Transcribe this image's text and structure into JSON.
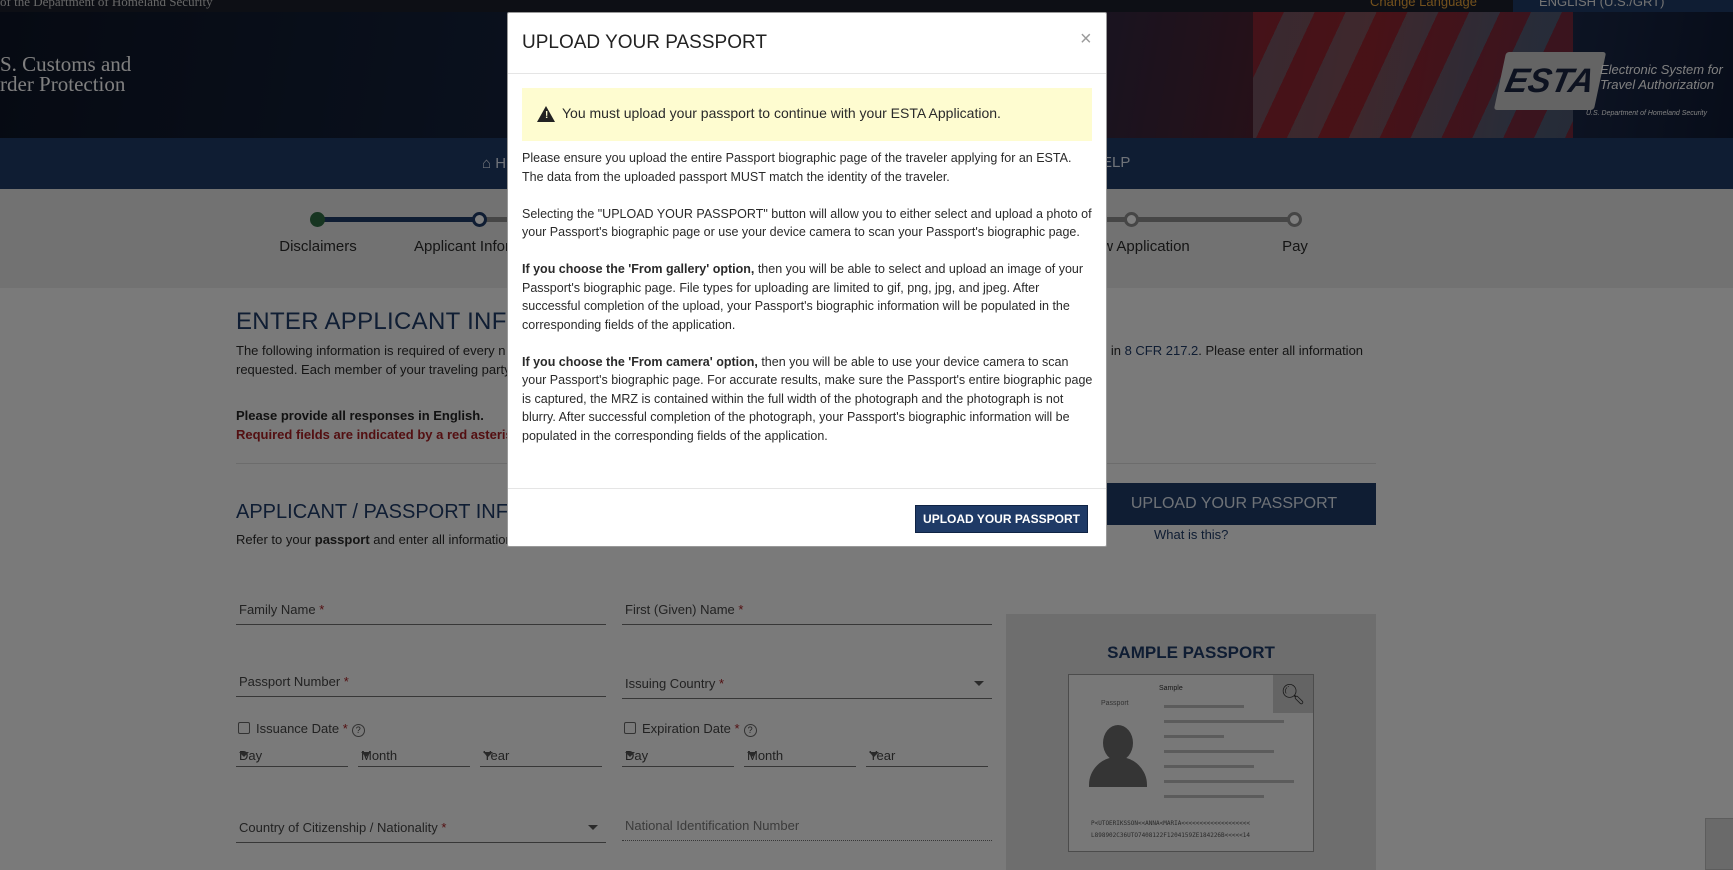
{
  "util": {
    "department": "of the Department of Homeland Security",
    "change_language": "Change Language",
    "language": "ENGLISH (U.S./GRT)"
  },
  "banner": {
    "agency_line1": "S. Customs and",
    "agency_line2": "rder Protection",
    "esta_badge": "ESTA",
    "esta_line1": "Electronic System for",
    "esta_line2": "Travel Authorization",
    "esta_sub": "U.S. Department of Homeland Security"
  },
  "nav": {
    "home": "H",
    "help": "ELP"
  },
  "progress": {
    "steps": [
      "Disclaimers",
      "Applicant Infor",
      "w Application",
      "Pay"
    ]
  },
  "page": {
    "title": "ENTER APPLICANT INFOI",
    "intro_line1": "The following information is required of every n",
    "intro_line1_right_prefix": "d in ",
    "intro_link": "8 CFR 217.2",
    "intro_line1_right_suffix": ". Please enter all information",
    "intro_line2": "requested. Each member of your traveling party",
    "english_note": "Please provide all responses in English.",
    "required_note": "Required fields are indicated by a red asterisk",
    "section_title": "APPLICANT / PASSPORT INFO",
    "refer_prefix": "Refer to your ",
    "refer_bold": "passport",
    "refer_suffix": " and enter all information",
    "upload_button": "UPLOAD YOUR PASSPORT",
    "what_is_this": "What is this?"
  },
  "form": {
    "family_name": "Family Name",
    "first_name": "First (Given) Name",
    "passport_number": "Passport Number",
    "issuing_country": "Issuing Country",
    "issuance_date": "Issuance Date",
    "expiration_date": "Expiration Date",
    "day": "Day",
    "month": "Month",
    "year": "Year",
    "citizenship": "Country of Citizenship / Nationality",
    "national_id": "National Identification Number",
    "required_mark": "*",
    "help_mark": "?"
  },
  "sample": {
    "title": "SAMPLE PASSPORT",
    "header_text": "Sample",
    "passport_word": "Passport",
    "mrz1": "P<UTOERIKSSON<<ANNA<MARIA<<<<<<<<<<<<<<<<<<<",
    "mrz2": "L898902C36UTO7408122F1204159ZE184226B<<<<<14"
  },
  "modal": {
    "title": "UPLOAD YOUR PASSPORT",
    "close": "×",
    "alert": "You must upload your passport to continue with your ESTA Application.",
    "para1": "Please ensure you upload the entire Passport biographic page of the traveler applying for an ESTA.  The data from the uploaded passport MUST match the identity of the traveler.",
    "para2": "Selecting the \"UPLOAD YOUR PASSPORT\" button will allow you to either select and upload a photo of your Passport's biographic page or use your device camera to scan your Passport's biographic page.",
    "para3_bold": "If you choose the 'From gallery' option,",
    "para3": " then you will be able to select and upload an image of your Passport's biographic page. File types for uploading are limited to gif, png, jpg, and jpeg. After successful completion of the upload, your Passport's biographic information will be populated in the corresponding fields of the application.",
    "para4_bold": "If you choose the 'From camera' option,",
    "para4": " then you will be able to use your device camera to scan your Passport's biographic page. For accurate results, make sure the Passport's entire biographic page is captured, the MRZ is contained within the full width of the photograph and the photograph is not blurry. After successful completion of the photograph, your Passport's biographic information will be populated in the corresponding fields of the application.",
    "button": "UPLOAD YOUR PASSPORT"
  }
}
